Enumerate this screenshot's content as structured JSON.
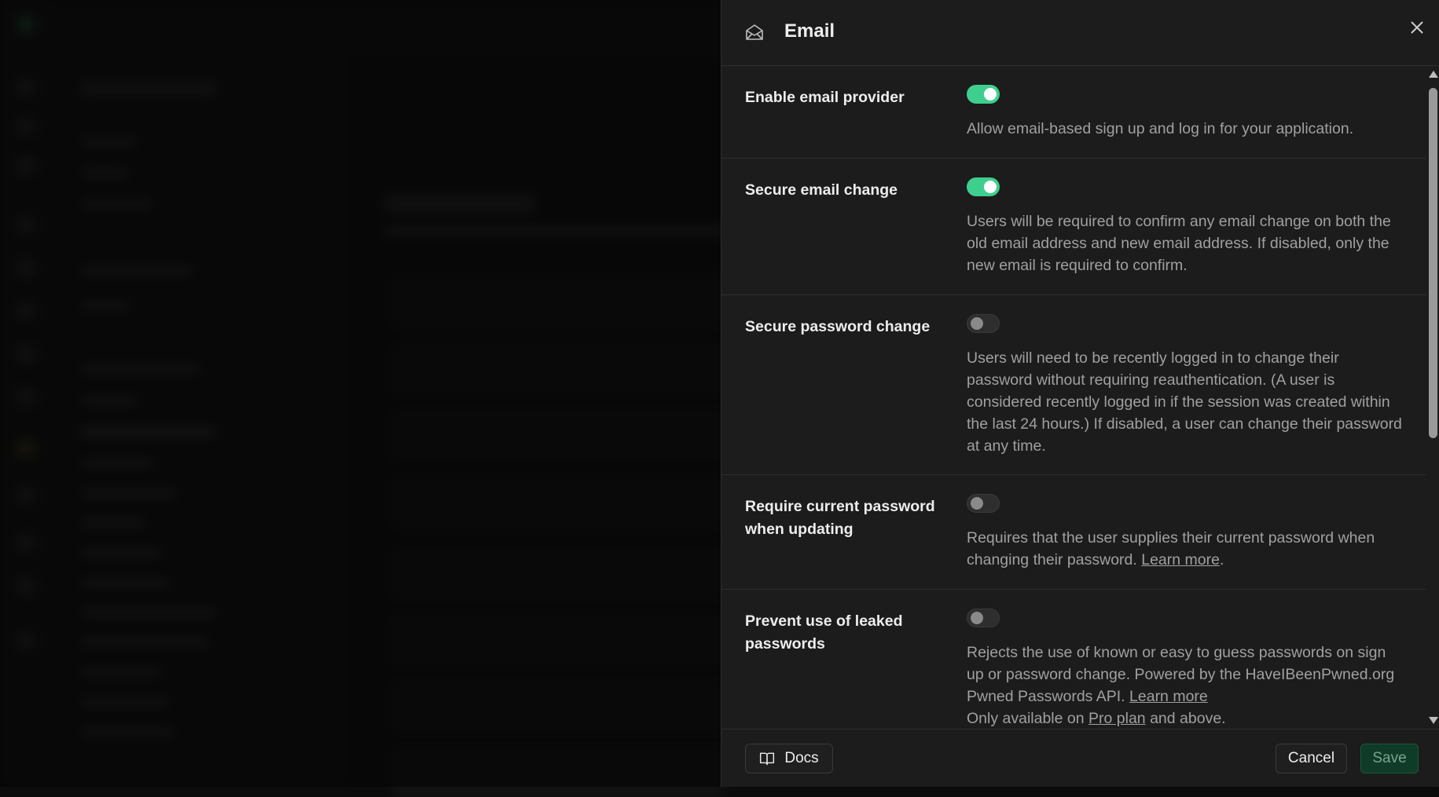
{
  "panel": {
    "title": "Email",
    "header_icon": "envelope-open-icon",
    "close_icon": "close-icon"
  },
  "settings": [
    {
      "key": "enable_email_provider",
      "label": "Enable email provider",
      "enabled": true,
      "description": "Allow email-based sign up and log in for your application."
    },
    {
      "key": "secure_email_change",
      "label": "Secure email change",
      "enabled": true,
      "description": "Users will be required to confirm any email change on both the old email address and new email address. If disabled, only the new email is required to confirm."
    },
    {
      "key": "secure_password_change",
      "label": "Secure password change",
      "enabled": false,
      "description": "Users will need to be recently logged in to change their password without requiring reauthentication. (A user is considered recently logged in if the session was created within the last 24 hours.) If disabled, a user can change their password at any time."
    },
    {
      "key": "require_current_password",
      "label": "Require current password when updating",
      "enabled": false,
      "description": "Requires that the user supplies their current password when changing their password.",
      "link_text": "Learn more",
      "trailing": "."
    },
    {
      "key": "prevent_leaked_passwords",
      "label": "Prevent use of leaked passwords",
      "enabled": false,
      "description": "Rejects the use of known or easy to guess passwords on sign up or password change. Powered by the HaveIBeenPwned.org Pwned Passwords API.",
      "link_text": "Learn more",
      "availability_prefix": "Only available on",
      "availability_link": "Pro plan",
      "availability_suffix": "and above."
    }
  ],
  "footer": {
    "docs_label": "Docs",
    "docs_icon": "book-open-icon",
    "cancel_label": "Cancel",
    "save_label": "Save"
  },
  "colors": {
    "toggle_on": "#3ecf8e",
    "panel_bg": "#1c1c1c",
    "save_bg": "#0f3b28"
  }
}
